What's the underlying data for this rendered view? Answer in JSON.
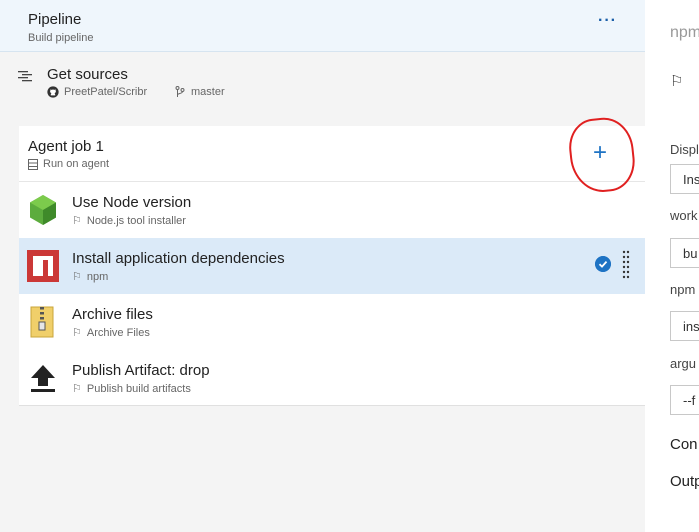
{
  "pipeline": {
    "title": "Pipeline",
    "subtitle": "Build pipeline",
    "more": "···"
  },
  "sources": {
    "label": "Get sources",
    "repo": "PreetPatel/Scribr",
    "branch": "master"
  },
  "job": {
    "title": "Agent job 1",
    "subtitle": "Run on agent",
    "add": "+"
  },
  "tasks": [
    {
      "name": "Use Node version",
      "sub": "Node.js tool installer"
    },
    {
      "name": "Install application dependencies",
      "sub": "npm"
    },
    {
      "name": "Archive files",
      "sub": "Archive Files"
    },
    {
      "name": "Publish Artifact: drop",
      "sub": "Publish build artifacts"
    }
  ],
  "right": {
    "heading": "npm",
    "display_label": "Displ",
    "display_value": "Ins",
    "work_label": "work",
    "work_value": "bu",
    "npm_label": "npm",
    "npm_value": "ins",
    "argu_label": "argu",
    "argu_value": "--f",
    "con_label": "Con",
    "out_label": "Outp"
  },
  "colors": {
    "accent": "#1e73c4",
    "selected": "#dbeaf8",
    "annotation": "#e02020"
  }
}
